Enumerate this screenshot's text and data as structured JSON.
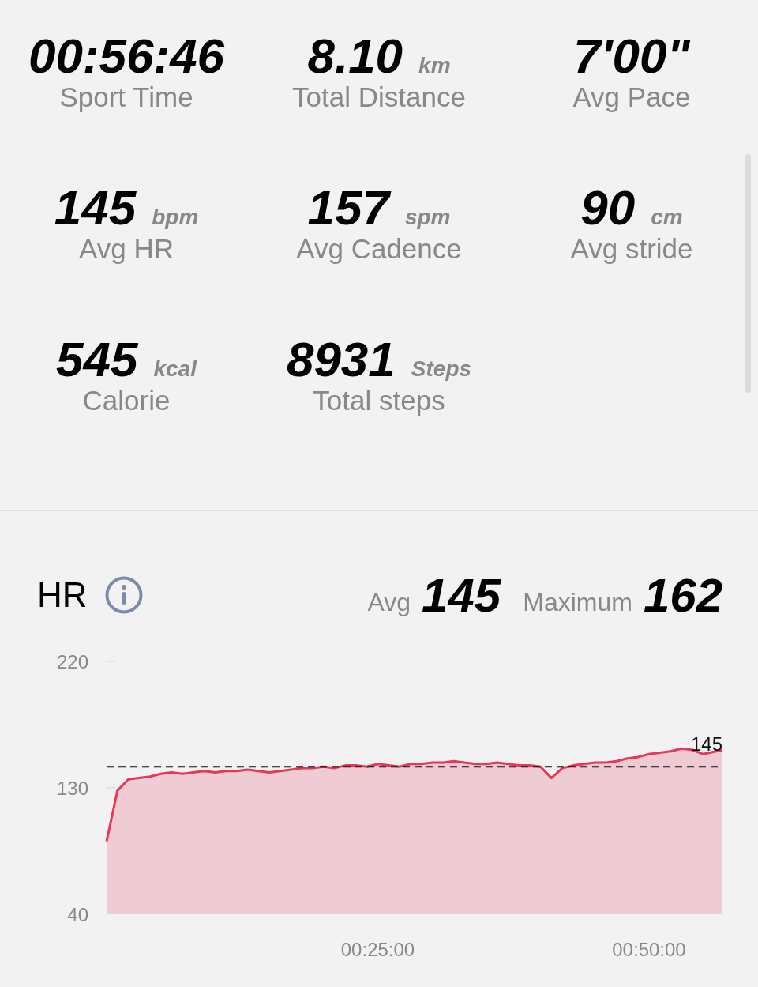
{
  "stats": [
    {
      "value": "00:56:46",
      "label": "Sport Time"
    },
    {
      "value": "8.10",
      "unit": "km",
      "label": "Total Distance"
    },
    {
      "value": "7'00\"",
      "label": "Avg Pace"
    },
    {
      "value": "145",
      "unit": "bpm",
      "label": "Avg HR"
    },
    {
      "value": "157",
      "unit": "spm",
      "label": "Avg Cadence"
    },
    {
      "value": "90",
      "unit": "cm",
      "label": "Avg stride"
    },
    {
      "value": "545",
      "unit": "kcal",
      "label": "Calorie"
    },
    {
      "value": "8931",
      "unit": "Steps",
      "label": "Total steps"
    }
  ],
  "hr": {
    "avg_label": "Avg",
    "avg_value": "145",
    "max_label": "Maximum",
    "max_value": "162",
    "chart_data": {
      "type": "area",
      "x": [
        0,
        1,
        2,
        3,
        4,
        5,
        6,
        7,
        8,
        9,
        10,
        11,
        12,
        13,
        14,
        15,
        16,
        17,
        18,
        19,
        20,
        21,
        22,
        23,
        24,
        25,
        26,
        27,
        28,
        29,
        30,
        31,
        32,
        33,
        34,
        35,
        36,
        37,
        38,
        39,
        40,
        41,
        42,
        43,
        44,
        45,
        46,
        47,
        48,
        49,
        50,
        51,
        52,
        53,
        54,
        55,
        56.77
      ],
      "series": [
        {
          "name": "HR",
          "color": "#e8375a",
          "values": [
            92,
            128,
            136,
            137,
            138,
            140,
            141,
            140,
            141,
            142,
            141,
            142,
            142,
            143,
            142,
            141,
            142,
            143,
            144,
            144,
            145,
            144,
            146,
            146,
            145,
            147,
            146,
            145,
            147,
            147,
            148,
            148,
            149,
            148,
            147,
            147,
            148,
            147,
            146,
            146,
            145,
            137,
            144,
            146,
            147,
            148,
            148,
            149,
            151,
            152,
            154,
            155,
            156,
            158,
            157,
            154,
            157
          ]
        }
      ],
      "xlim": [
        0,
        56.77
      ],
      "ylim": [
        40,
        220
      ],
      "xticks": [
        {
          "value": 25,
          "label": "00:25:00"
        },
        {
          "value": 50,
          "label": "00:50:00"
        }
      ],
      "yticks": [
        40,
        130,
        220
      ],
      "ref_lines": [
        {
          "axis": "y",
          "value": 145,
          "label": "145"
        }
      ]
    }
  }
}
